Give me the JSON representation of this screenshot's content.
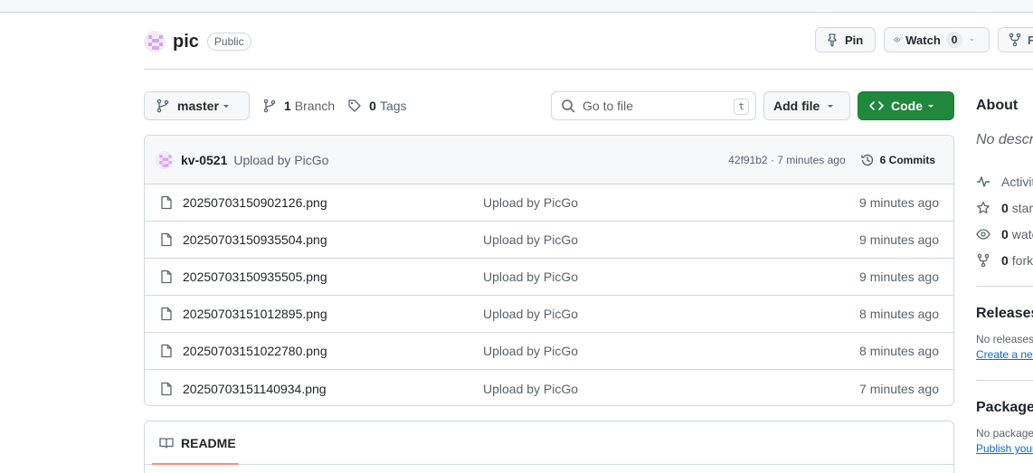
{
  "repo": {
    "name": "pic",
    "visibility": "Public"
  },
  "header_actions": {
    "pin_label": "Pin",
    "watch_label": "Watch",
    "watch_count": "0",
    "fork_label": "F"
  },
  "toolbar": {
    "branch_name": "master",
    "branch_count": "1",
    "branch_label": "Branch",
    "tag_count": "0",
    "tag_label": "Tags",
    "goto_placeholder": "Go to file",
    "goto_shortcut": "t",
    "add_file_label": "Add file",
    "code_label": "Code"
  },
  "latest_commit": {
    "author": "kv-0521",
    "message": "Upload by PicGo",
    "hash_time": "42f91b2 · 7 minutes ago",
    "commits_label": "6 Commits"
  },
  "files": [
    {
      "name": "20250703150902126.png",
      "message": "Upload by PicGo",
      "time": "9 minutes ago"
    },
    {
      "name": "20250703150935504.png",
      "message": "Upload by PicGo",
      "time": "9 minutes ago"
    },
    {
      "name": "20250703150935505.png",
      "message": "Upload by PicGo",
      "time": "9 minutes ago"
    },
    {
      "name": "20250703151012895.png",
      "message": "Upload by PicGo",
      "time": "8 minutes ago"
    },
    {
      "name": "20250703151022780.png",
      "message": "Upload by PicGo",
      "time": "8 minutes ago"
    },
    {
      "name": "20250703151140934.png",
      "message": "Upload by PicGo",
      "time": "7 minutes ago"
    }
  ],
  "readme": {
    "tab_label": "README"
  },
  "sidebar": {
    "about_heading": "About",
    "description": "No descri",
    "activity_label": "Activit",
    "stars_count": "0",
    "stars_label": "star",
    "watchers_count": "0",
    "watchers_label": "wate",
    "forks_count": "0",
    "forks_label": "fork",
    "releases_heading": "Releases",
    "releases_text": "No releases",
    "releases_link": "Create a nev",
    "packages_heading": "Packages",
    "packages_text": "No package",
    "packages_link": "Publish your"
  },
  "colors": {
    "accent_green": "#1f883d",
    "link_blue": "#0969da",
    "border": "#d1d9e0",
    "muted": "#59636e",
    "tab_underline": "#fd8c73"
  }
}
